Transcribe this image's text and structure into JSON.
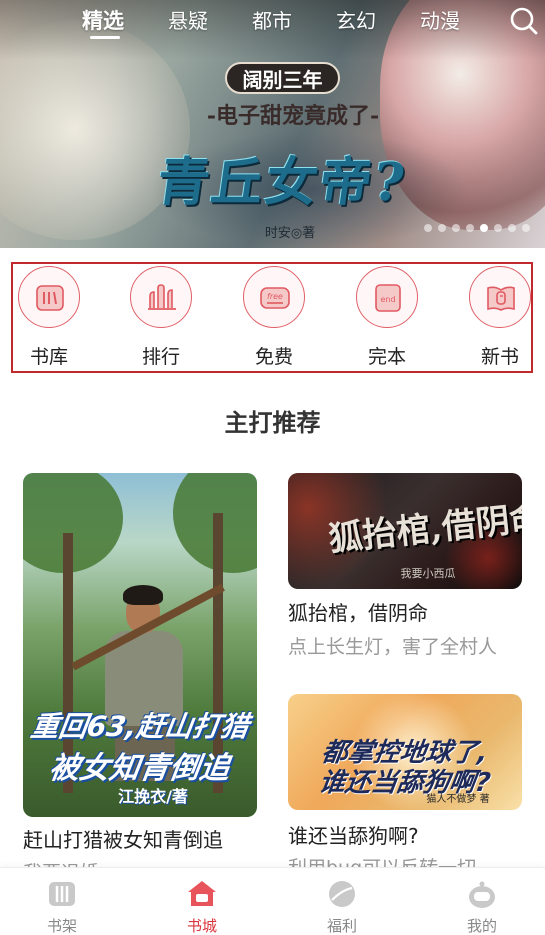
{
  "top_tabs": [
    {
      "label": "精选",
      "active": true
    },
    {
      "label": "悬疑",
      "active": false
    },
    {
      "label": "都市",
      "active": false
    },
    {
      "label": "玄幻",
      "active": false
    },
    {
      "label": "动漫",
      "active": false
    }
  ],
  "search_icon": "search-icon",
  "banner": {
    "tag": "阔别三年",
    "subtitle": "-电子甜宠竟成了-",
    "title": "青丘女帝?",
    "author": "时安◎著",
    "total_slides": 8,
    "active_slide": 5
  },
  "categories": [
    {
      "label": "书库",
      "icon": "library-icon"
    },
    {
      "label": "排行",
      "icon": "ranking-icon"
    },
    {
      "label": "免费",
      "icon": "free-icon"
    },
    {
      "label": "完本",
      "icon": "completed-icon"
    },
    {
      "label": "新书",
      "icon": "new-book-icon"
    }
  ],
  "section_title": "主打推荐",
  "feature_book": {
    "cover_line1": "重回63,赶山打猎",
    "cover_line2": "被女知青倒追",
    "cover_author": "江挽衣/著",
    "title": "赶山打猎被女知青倒追",
    "desc": "我要退婚"
  },
  "side_books": [
    {
      "cover_text": "狐抬棺,借阴命",
      "cover_author": "我要小西瓜",
      "title": "狐抬棺，借阴命",
      "desc": "点上长生灯，害了全村人"
    },
    {
      "cover_line1": "都掌控地球了,",
      "cover_line2": "谁还当舔狗啊?",
      "cover_author": "猫人不做梦 著",
      "title": "谁还当舔狗啊?",
      "desc": "利用bug可以反转一切"
    }
  ],
  "bottom_nav": [
    {
      "label": "书架",
      "icon": "bookshelf-icon",
      "active": false
    },
    {
      "label": "书城",
      "icon": "bookstore-icon",
      "active": true
    },
    {
      "label": "福利",
      "icon": "welfare-icon",
      "active": false
    },
    {
      "label": "我的",
      "icon": "profile-icon",
      "active": false
    }
  ],
  "colors": {
    "accent": "#d9373d",
    "category_border": "#c0282d",
    "text_primary": "#222222",
    "text_secondary": "#999999",
    "nav_inactive": "#888888"
  }
}
